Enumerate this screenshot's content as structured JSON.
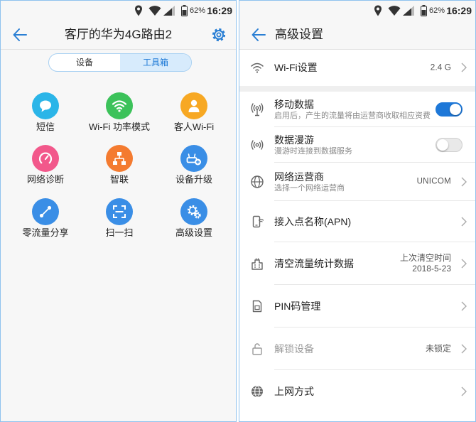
{
  "status_bar": {
    "battery": "62%",
    "time": "16:29"
  },
  "colors": {
    "accent": "#2a7fd4",
    "toggle_on": "#1e78d8"
  },
  "left": {
    "title": "客厅的华为4G路由2",
    "segments": [
      {
        "label": "设备",
        "selected": false
      },
      {
        "label": "工具箱",
        "selected": true
      }
    ],
    "grid": [
      {
        "label": "短信",
        "icon": "message-icon",
        "color": "#2bb5e8"
      },
      {
        "label": "Wi-Fi 功率模式",
        "icon": "wifi-power-icon",
        "color": "#3cc25a"
      },
      {
        "label": "客人Wi-Fi",
        "icon": "guest-user-icon",
        "color": "#f7a823"
      },
      {
        "label": "网络诊断",
        "icon": "gauge-icon",
        "color": "#f2588b"
      },
      {
        "label": "智联",
        "icon": "network-tree-icon",
        "color": "#f47b30"
      },
      {
        "label": "设备升级",
        "icon": "router-upgrade-icon",
        "color": "#3a8ee6"
      },
      {
        "label": "零流量分享",
        "icon": "share-icon",
        "color": "#3a8ee6"
      },
      {
        "label": "扫一扫",
        "icon": "scan-icon",
        "color": "#3a8ee6"
      },
      {
        "label": "高级设置",
        "icon": "gears-icon",
        "color": "#3a8ee6"
      }
    ]
  },
  "right": {
    "title": "高级设置",
    "rows": [
      {
        "title": "Wi-Fi设置",
        "value": "2.4 G",
        "icon": "wifi-icon"
      },
      {
        "title": "移动数据",
        "subtitle": "启用后，产生的流量将由运营商收取相应资费",
        "toggle": true,
        "icon": "mobile-data-icon"
      },
      {
        "title": "数据漫游",
        "subtitle": "漫游时连接到数据服务",
        "toggle": false,
        "icon": "roaming-icon"
      },
      {
        "title": "网络运营商",
        "subtitle": "选择一个网络运营商",
        "value": "UNICOM",
        "icon": "globe-icon"
      },
      {
        "title": "接入点名称(APN)",
        "icon": "apn-phone-icon"
      },
      {
        "title": "清空流量统计数据",
        "value_line1": "上次清空时间",
        "value_line2": "2018-5-23",
        "icon": "traffic-stats-icon"
      },
      {
        "title": "PIN码管理",
        "icon": "sim-card-icon"
      },
      {
        "title": "解锁设备",
        "value": "未锁定",
        "disabled": true,
        "icon": "unlock-icon"
      },
      {
        "title": "上网方式",
        "icon": "internet-globe-icon"
      }
    ]
  }
}
